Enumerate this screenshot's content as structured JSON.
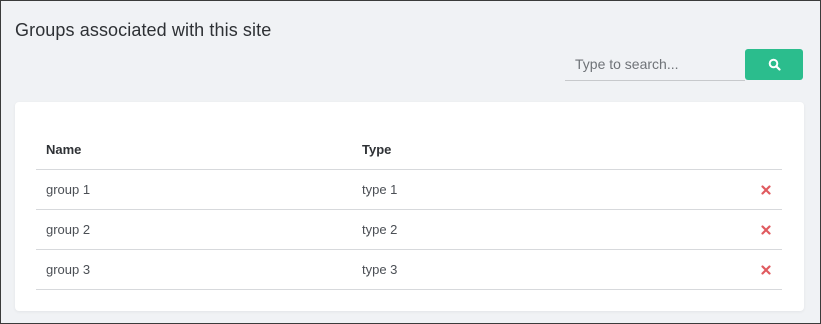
{
  "header": {
    "title": "Groups associated with this site"
  },
  "search": {
    "placeholder": "Type to search...",
    "value": "",
    "button_icon": "search-icon",
    "button_color": "#2bbd8d"
  },
  "table": {
    "columns": [
      "Name",
      "Type"
    ],
    "rows": [
      {
        "name": "group 1",
        "type": "type 1",
        "action_icon": "delete-icon"
      },
      {
        "name": "group 2",
        "type": "type 2",
        "action_icon": "delete-icon"
      },
      {
        "name": "group 3",
        "type": "type 3",
        "action_icon": "delete-icon"
      }
    ],
    "delete_icon_color": "#e05a5f"
  }
}
